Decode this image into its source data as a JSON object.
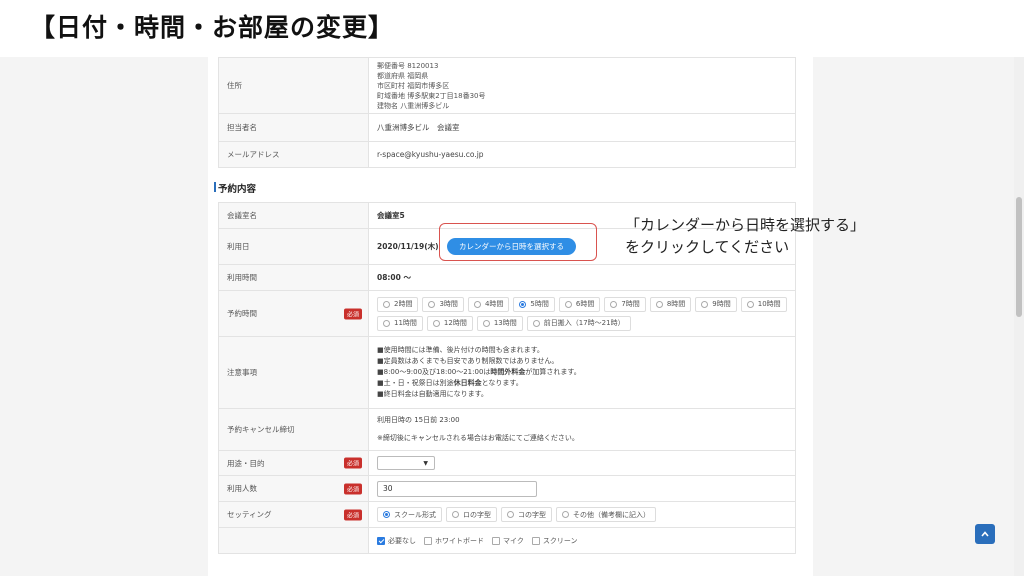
{
  "slide": {
    "title": "【日付・時間・お部屋の変更】"
  },
  "contact": {
    "address_label": "住所",
    "address_lines": [
      "郵便番号 8120013",
      "都道府県 福岡県",
      "市区町村 福岡市博多区",
      "町域番地 博多駅東2丁目18番30号",
      "建物名 八重洲博多ビル"
    ],
    "person_label": "担当者名",
    "person_value": "八重洲博多ビル　会議室",
    "email_label": "メールアドレス",
    "email_value": "r-space@kyushu-yaesu.co.jp"
  },
  "reservation": {
    "section_title": "予約内容",
    "room_label": "会議室名",
    "room_value": "会議室5",
    "date_label": "利用日",
    "date_value": "2020/11/19(木)",
    "calendar_button": "カレンダーから日時を選択する",
    "time_label": "利用時間",
    "time_value": "08:00 ～",
    "duration_label": "予約時間",
    "required": "必須",
    "duration_options": [
      "2時間",
      "3時間",
      "4時間",
      "5時間",
      "6時間",
      "7時間",
      "8時間",
      "9時間",
      "10時間",
      "11時間",
      "12時間",
      "13時間",
      "前日搬入（17時～21時）"
    ],
    "duration_selected": "5時間",
    "notes_label": "注意事項",
    "notes": {
      "line1": "■使用時間には準備、後片付けの時間も含まれます。",
      "line2": "■定員数はあくまでも目安であり制限数ではありません。",
      "line3_a": "■8:00～9:00及び18:00～21:00は",
      "line3_b": "時間外料金",
      "line3_c": "が加算されます。",
      "line4_a": "■土・日・祝祭日は別途",
      "line4_b": "休日料金",
      "line4_c": "となります。",
      "line5": "■終日料金は自動適用になります。"
    },
    "cancel_label": "予約キャンセル締切",
    "cancel_value": "利用日時の 15日前 23:00",
    "cancel_note": "※締切後にキャンセルされる場合はお電話にてご連絡ください。",
    "purpose_label": "用途・目的",
    "people_label": "利用人数",
    "people_value": "30",
    "setting_label": "セッティング",
    "setting_options": [
      "スクール形式",
      "ロの字型",
      "コの字型",
      "その他（備考欄に記入）"
    ],
    "setting_selected": "スクール形式",
    "equipment_options": [
      "必要なし",
      "ホワイトボード",
      "マイク",
      "スクリーン"
    ],
    "equipment_checked": "必要なし"
  },
  "annotation": {
    "line1": "「カレンダーから日時を選択する」",
    "line2": "をクリックしてください"
  },
  "colors": {
    "accent": "#2f8ee5",
    "required": "#c9302c",
    "highlight": "#d9534f",
    "scroll_top": "#2a6ebb"
  },
  "icons": {
    "select_caret": "caret-down-icon",
    "scroll_top": "chevron-up-icon"
  }
}
